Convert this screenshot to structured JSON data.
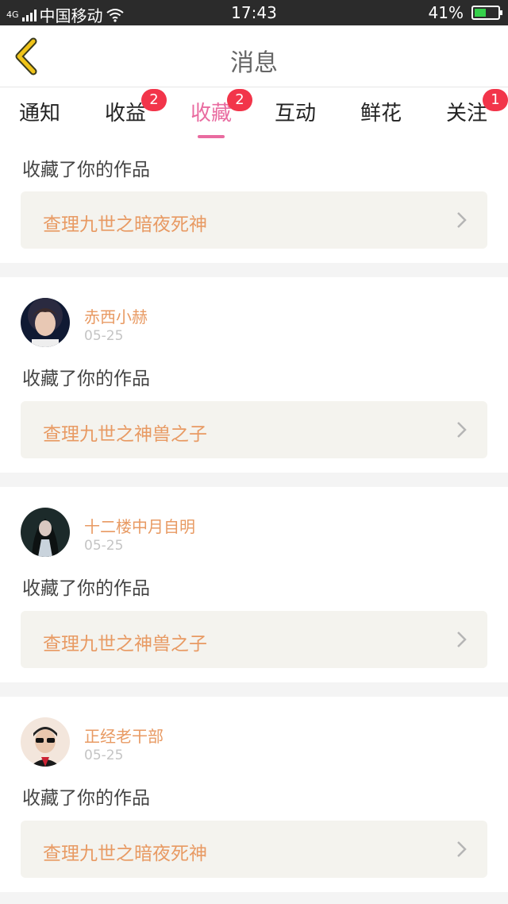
{
  "status": {
    "carrier": "中国移动",
    "time": "17:43",
    "battery": "41%",
    "net": "4G"
  },
  "header": {
    "title": "消息"
  },
  "tabs": [
    {
      "label": "通知",
      "badge": ""
    },
    {
      "label": "收益",
      "badge": "2"
    },
    {
      "label": "收藏",
      "badge": "2",
      "active": true
    },
    {
      "label": "互动",
      "badge": ""
    },
    {
      "label": "鲜花",
      "badge": ""
    },
    {
      "label": "关注",
      "badge": "1"
    }
  ],
  "items": [
    {
      "user": "",
      "date": "",
      "desc": "收藏了你的作品",
      "work": "查理九世之暗夜死神"
    },
    {
      "user": "赤西小赫",
      "date": "05-25",
      "desc": "收藏了你的作品",
      "work": "查理九世之神兽之子"
    },
    {
      "user": "十二楼中月自明",
      "date": "05-25",
      "desc": "收藏了你的作品",
      "work": "查理九世之神兽之子"
    },
    {
      "user": "正经老干部",
      "date": "05-25",
      "desc": "收藏了你的作品",
      "work": "查理九世之暗夜死神"
    }
  ],
  "colors": {
    "accent": "#e96ba0",
    "badge": "#f2354a",
    "orange": "#e89a63",
    "back": "#f0c419"
  }
}
